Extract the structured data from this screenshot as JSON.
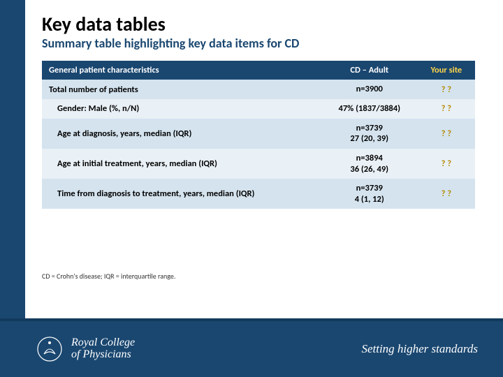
{
  "title": "Key data tables",
  "subtitle": "Summary table highlighting key data items for CD",
  "table": {
    "header": {
      "c1": "General patient characteristics",
      "c2": "CD – Adult",
      "c3": "Your site"
    },
    "rows": [
      {
        "label": "Total number of patients",
        "indent": false,
        "value": "n=3900",
        "your": "? ?"
      },
      {
        "label": "Gender: Male (%, n/N)",
        "indent": true,
        "value": "47% (1837/3884)",
        "your": "? ?"
      },
      {
        "label": "Age at diagnosis, years, median (IQR)",
        "indent": true,
        "value": "n=3739\n27 (20, 39)",
        "your": "? ?"
      },
      {
        "label": "Age at initial treatment, years, median (IQR)",
        "indent": true,
        "value": "n=3894\n36 (26, 49)",
        "your": "? ?"
      },
      {
        "label": "Time from diagnosis to treatment, years, median (IQR)",
        "indent": true,
        "value": "n=3739\n4 (1, 12)",
        "your": "? ?"
      }
    ]
  },
  "footnote": "CD = Crohn's disease; IQR = interquartile range.",
  "footer": {
    "org_line1": "Royal College",
    "org_line2": "of Physicians",
    "tagline": "Setting higher standards"
  }
}
